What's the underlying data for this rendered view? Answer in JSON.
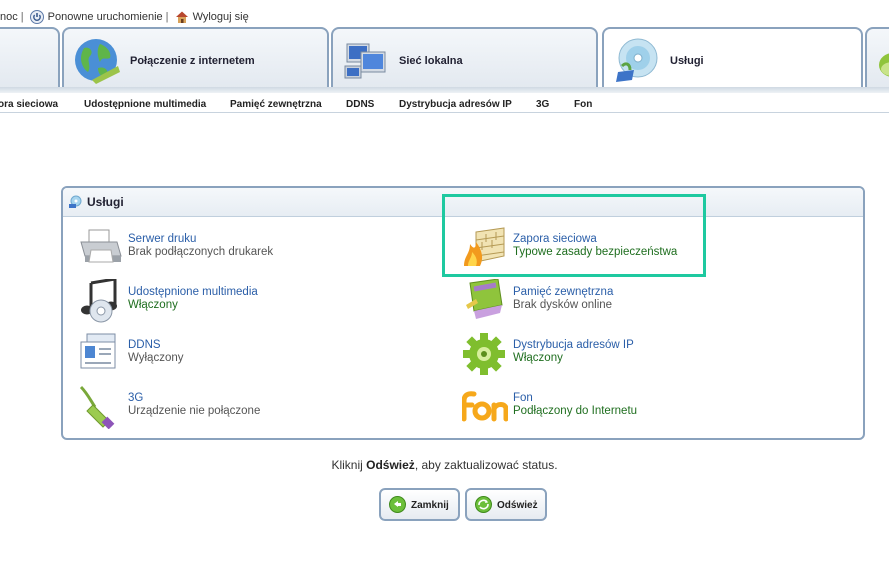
{
  "toplinks": {
    "help": "noc",
    "restart": "Ponowne uruchomienie",
    "logout": "Wyloguj się"
  },
  "tabs": [
    {
      "label": "Połączenie z internetem"
    },
    {
      "label": "Sieć lokalna"
    },
    {
      "label": "Usługi"
    }
  ],
  "subnav": [
    "ora sieciowa",
    "Udostępnione multimedia",
    "Pamięć zewnętrzna",
    "DDNS",
    "Dystrybucja adresów IP",
    "3G",
    "Fon"
  ],
  "panel": {
    "title": "Usługi",
    "services": [
      {
        "name": "Serwer druku",
        "status": "Brak podłączonych drukarek"
      },
      {
        "name": "Zapora sieciowa",
        "status": "Typowe zasady bezpieczeństwa"
      },
      {
        "name": "Udostępnione multimedia",
        "status": "Włączony"
      },
      {
        "name": "Pamięć zewnętrzna",
        "status": "Brak dysków online"
      },
      {
        "name": "DDNS",
        "status": "Wyłączony"
      },
      {
        "name": "Dystrybucja adresów IP",
        "status": "Włączony"
      },
      {
        "name": "3G",
        "status": "Urządzenie nie połączone"
      },
      {
        "name": "Fon",
        "status": "Podłączony do Internetu"
      }
    ]
  },
  "hint": {
    "before": "Kliknij ",
    "bold": "Odśwież",
    "after": ", aby zaktualizować status."
  },
  "buttons": {
    "close": "Zamknij",
    "refresh": "Odśwież"
  },
  "icons": {
    "restart": "power-icon",
    "logout": "house-icon",
    "internet": "globe-icon",
    "lan": "computers-icon",
    "services": "cd-icon",
    "printer": "printer-icon",
    "firewall": "firewall-icon",
    "multimedia": "music-notes-icon",
    "storage": "usb-stick-icon",
    "ddns": "id-card-icon",
    "dhcp": "gear-icon",
    "3g": "cable-icon",
    "fon": "fon-logo-icon"
  },
  "colors": {
    "highlight": "#1ec9a0",
    "link": "#2a5ea8",
    "status_green": "#1f6e1f",
    "border": "#8aa2bd"
  }
}
